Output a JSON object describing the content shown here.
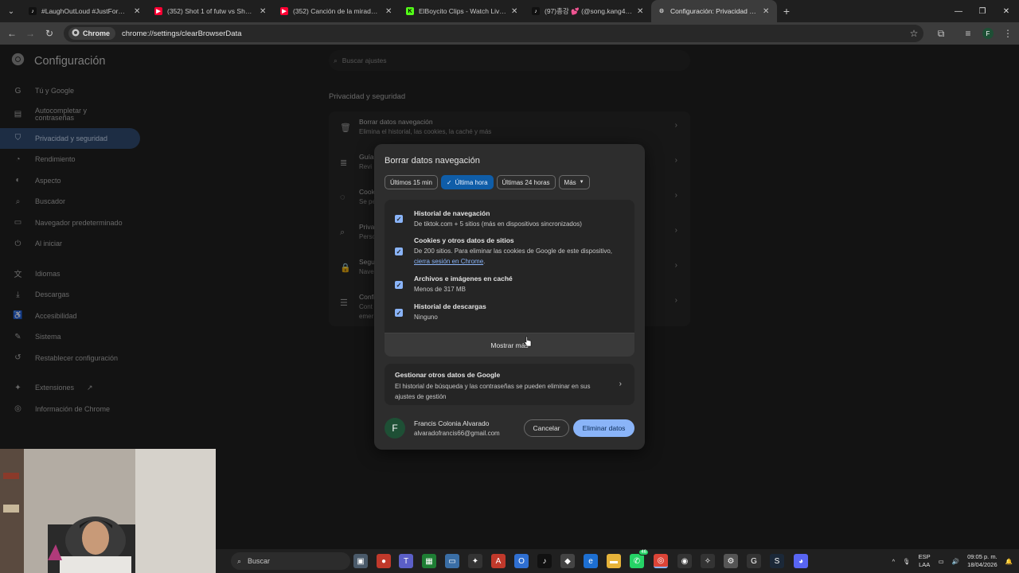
{
  "browser": {
    "tabs": [
      {
        "title": "#LaughOutLoud #JustForFun #",
        "favicon": "tiktok-icon",
        "active": false
      },
      {
        "title": "(352) Shot 1 of futw vs Shot 2",
        "favicon": "youtube-icon",
        "active": false
      },
      {
        "title": "(352) Canción de la mirada de",
        "favicon": "youtube-icon",
        "active": false
      },
      {
        "title": "ElBoycito Clips - Watch Live on",
        "favicon": "kick-icon",
        "active": false
      },
      {
        "title": "(97)총강 💕 (@song.kang478)",
        "favicon": "tiktok-icon",
        "active": false
      },
      {
        "title": "Configuración: Privacidad y seg",
        "favicon": "gear-icon",
        "active": true
      }
    ],
    "omnibox": {
      "chip_label": "Chrome",
      "url": "chrome://settings/clearBrowserData"
    },
    "profile_initial": "F"
  },
  "settings": {
    "title": "Configuración",
    "search_placeholder": "Buscar ajustes",
    "nav": [
      {
        "label": "Tú y Google",
        "icon": "google-icon"
      },
      {
        "label": "Autocompletar y contraseñas",
        "icon": "clipboard-icon"
      },
      {
        "label": "Privacidad y seguridad",
        "icon": "shield-icon",
        "selected": true
      },
      {
        "label": "Rendimiento",
        "icon": "speedometer-icon"
      },
      {
        "label": "Aspecto",
        "icon": "palette-icon"
      },
      {
        "label": "Buscador",
        "icon": "search-icon"
      },
      {
        "label": "Navegador predeterminado",
        "icon": "browser-icon"
      },
      {
        "label": "Al iniciar",
        "icon": "power-icon"
      },
      {
        "label": "Idiomas",
        "icon": "translate-icon"
      },
      {
        "label": "Descargas",
        "icon": "download-icon"
      },
      {
        "label": "Accesibilidad",
        "icon": "accessibility-icon"
      },
      {
        "label": "Sistema",
        "icon": "wrench-icon"
      },
      {
        "label": "Restablecer configuración",
        "icon": "reset-icon"
      },
      {
        "label": "Extensiones",
        "icon": "puzzle-icon"
      },
      {
        "label": "Información de Chrome",
        "icon": "chrome-icon"
      }
    ],
    "section_heading": "Privacidad y seguridad",
    "card_rows": [
      {
        "title": "Borrar datos navegación",
        "desc": "Elimina el historial, las cookies, la caché y más"
      },
      {
        "title": "Guía",
        "desc": "Revi"
      },
      {
        "title": "Cook",
        "desc": "Se pe"
      },
      {
        "title": "Priva",
        "desc": "Perso"
      },
      {
        "title": "Segu",
        "desc": "Nave"
      },
      {
        "title": "Confi",
        "desc": "Cont"
      },
      {
        "title": "",
        "desc": "emer"
      }
    ]
  },
  "dialog": {
    "title": "Borrar datos navegación",
    "time_chips": [
      {
        "label": "Últimos 15 min",
        "selected": false
      },
      {
        "label": "Última hora",
        "selected": true
      },
      {
        "label": "Últimas 24 horas",
        "selected": false
      },
      {
        "label": "Más",
        "selected": false
      }
    ],
    "options": [
      {
        "title": "Historial de navegación",
        "desc": "De tiktok.com + 5 sitios (más en dispositivos sincronizados)",
        "checked": true
      },
      {
        "title": "Cookies y otros datos de sitios",
        "desc": "De 200 sitios. Para eliminar las cookies de Google de este dispositivo,",
        "link": "cierra sesión en Chrome",
        "link_suffix": ".",
        "checked": true
      },
      {
        "title": "Archivos e imágenes en caché",
        "desc": "Menos de 317 MB",
        "checked": true
      },
      {
        "title": "Historial de descargas",
        "desc": "Ninguno",
        "checked": true
      }
    ],
    "show_more": "Mostrar más",
    "google_card": {
      "title": "Gestionar otros datos de Google",
      "desc": "El historial de búsqueda y las contraseñas se pueden eliminar en sus ajustes de gestión"
    },
    "account": {
      "initial": "F",
      "name": "Francis Colonia Alvarado",
      "email": "alvaradofrancis66@gmail.com"
    },
    "cancel": "Cancelar",
    "delete": "Eliminar datos"
  },
  "taskbar": {
    "search_placeholder": "Buscar",
    "lang_top": "ESP",
    "lang_bottom": "LAA",
    "time": "09:05 p. m.",
    "date": "18/04/2026",
    "badge_whatsapp": "46"
  },
  "colors": {
    "accent": "#8ab4f8",
    "selected_nav": "#2f4a6e",
    "chip_selected": "#0f5da8"
  }
}
